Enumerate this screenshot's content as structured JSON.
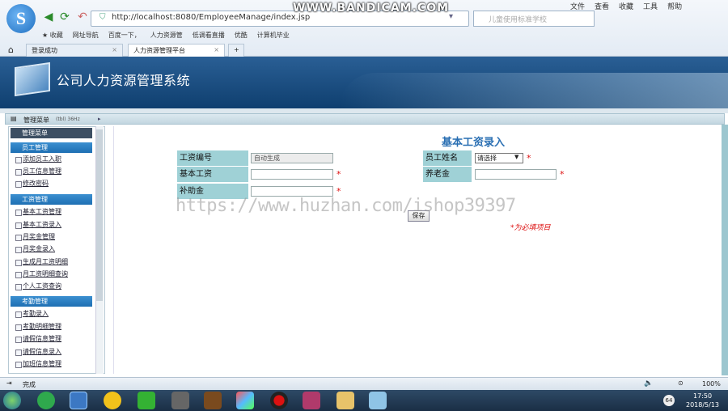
{
  "browser": {
    "url": "http://localhost:8080/EmployeeManage/index.jsp",
    "search_placeholder": "儿童使用标准学校",
    "menu": [
      "文件",
      "查看",
      "收藏",
      "工具",
      "帮助"
    ],
    "bookmarks": [
      "收藏",
      "网址导航",
      "百度一下，",
      "人力资源管",
      "低调看直播",
      "优酷",
      "计算机毕业"
    ],
    "tabs": [
      "登录成功",
      "人力资源管理平台"
    ],
    "status_text": "完成",
    "zoom": "100%",
    "recorder_watermark": "WWW.BANDICAM.COM"
  },
  "app": {
    "title": "公司人力资源管理系统",
    "menu_header": "管理菜单",
    "menu_header_small": "(tbl) 36Hz"
  },
  "sidebar": {
    "top_label": "管理菜单",
    "groups": [
      {
        "label": "员工管理",
        "items": [
          "添加员工入职",
          "员工信息管理",
          "修改密码"
        ]
      },
      {
        "label": "工资管理",
        "items": [
          "基本工资管理",
          "基本工资录入",
          "月奖金管理",
          "月奖金录入",
          "生成月工资明细",
          "月工资明细查询",
          "个人工资查询"
        ]
      },
      {
        "label": "考勤管理",
        "items": [
          "考勤录入",
          "考勤明细管理",
          "请假信息管理",
          "请假信息录入",
          "加班信息管理"
        ]
      }
    ]
  },
  "form": {
    "title": "基本工资录入",
    "fields": {
      "salary_no": {
        "label": "工资编号",
        "value": "自动生成"
      },
      "employee": {
        "label": "员工姓名",
        "selected": "请选择"
      },
      "base_salary": {
        "label": "基本工资",
        "value": ""
      },
      "pension": {
        "label": "养老金",
        "value": ""
      },
      "allowance": {
        "label": "补助金",
        "value": ""
      }
    },
    "required_mark": "*",
    "save_label": "保存",
    "required_note": "*为必填项目"
  },
  "watermark": "https://www.huzhan.com/ishop39397",
  "clock": {
    "time": "17:50",
    "date": "2018/5/13"
  },
  "tray_badge": "64"
}
